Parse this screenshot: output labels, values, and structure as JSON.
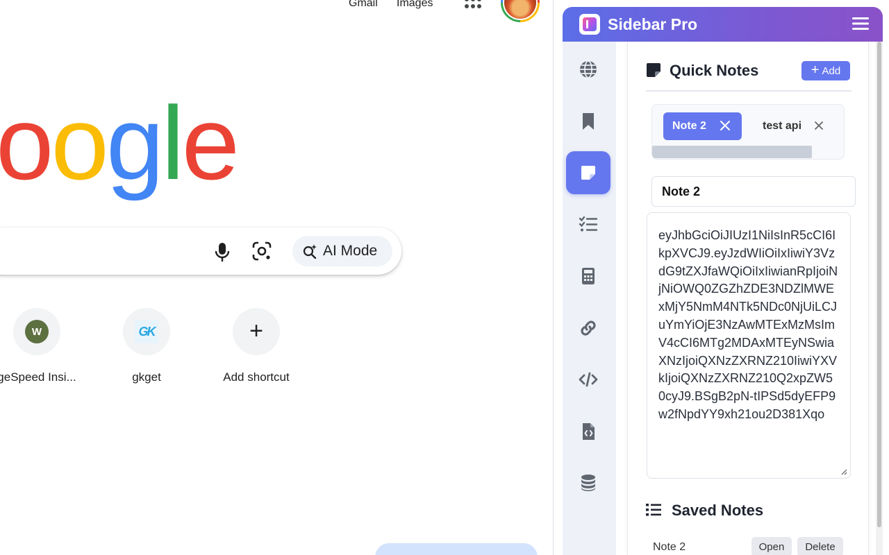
{
  "google": {
    "top_links": {
      "gmail": "Gmail",
      "images": "Images"
    },
    "logo": {
      "letters": [
        "o",
        "o",
        "g",
        "l",
        "e"
      ],
      "colors": [
        "#ea4335",
        "#fbbc05",
        "#4285f4",
        "#34a853",
        "#ea4335"
      ]
    },
    "search": {
      "ai_mode_label": "AI Mode"
    },
    "shortcuts": [
      {
        "label": "geSpeed Insi...",
        "icon": "W"
      },
      {
        "label": "gkget",
        "icon": "GK"
      },
      {
        "label": "Add shortcut",
        "icon": "+"
      }
    ]
  },
  "sidebar_pro": {
    "title": "Sidebar Pro",
    "rail_icons": [
      "globe-icon",
      "bookmark-icon",
      "sticky-note-icon",
      "checklist-icon",
      "calculator-icon",
      "link-icon",
      "code-icon",
      "file-code-icon",
      "database-icon"
    ],
    "active_rail_item": "sticky-note-icon",
    "quick_notes": {
      "title": "Quick Notes",
      "add_label": "Add",
      "tabs": [
        {
          "label": "Note 2",
          "active": true
        },
        {
          "label": "test api",
          "active": false
        }
      ],
      "note_title": "Note 2",
      "note_body": "eyJhbGciOiJIUzI1NiIsInR5cCI6IkpXVCJ9.eyJzdWIiOiIxIiwiY3VzdG9tZXJfaWQiOiIxIiwianRpIjoiNjNiOWQ0ZGZhZDE3NDZlMWExMjY5NmM4NTk5NDc0NjUiLCJuYmYiOjE3NzAwMTExMzMsImV4cCI6MTg2MDAxMTEyNSwiaXNzIjoiQXNzZXRNZ210IiwiYXVkIjoiQXNzZXRNZ210Q2xpZW50cyJ9.BSgB2pN-tIPSd5dyEFP9w2fNpdYY9xh21ou2D381Xqo"
    },
    "saved_notes": {
      "title": "Saved Notes",
      "items": [
        {
          "name": "Note 2",
          "open_label": "Open",
          "delete_label": "Delete"
        }
      ]
    },
    "accent_color": "#6577ee"
  }
}
